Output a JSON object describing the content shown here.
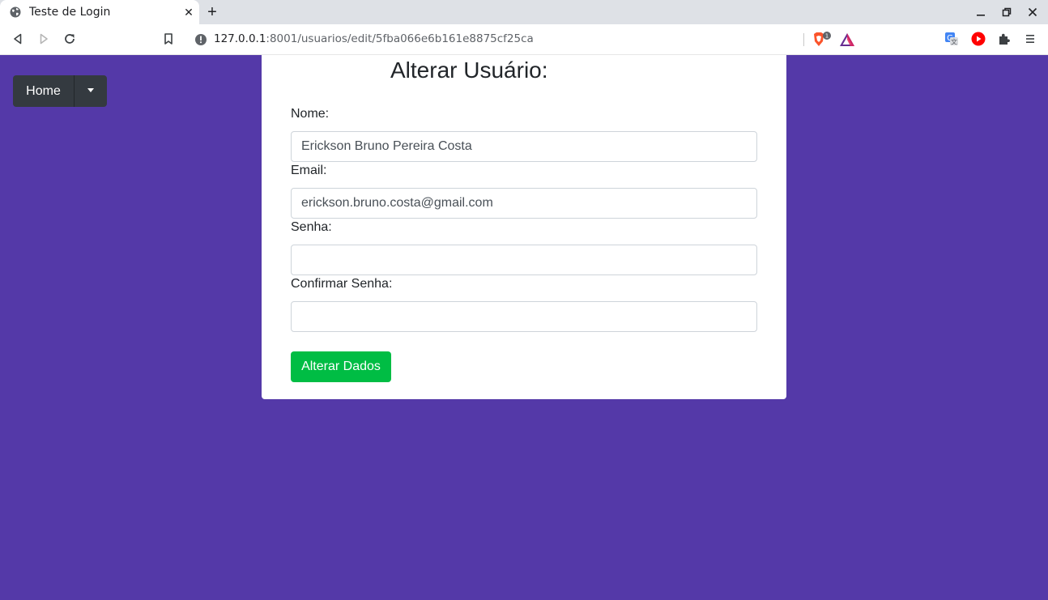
{
  "browser": {
    "tab_title": "Teste de Login",
    "close_symbol": "✕",
    "new_tab_symbol": "+",
    "url_host": "127.0.0.1",
    "url_rest": ":8001/usuarios/edit/5fba066e6b161e8875cf25ca",
    "brave_badge_count": "1"
  },
  "nav": {
    "home_label": "Home"
  },
  "form": {
    "title": "Alterar Usuário:",
    "name_label": "Nome:",
    "name_value": "Erickson Bruno Pereira Costa",
    "email_label": "Email:",
    "email_value": "erickson.bruno.costa@gmail.com",
    "password_label": "Senha:",
    "password_value": "",
    "confirm_label": "Confirmar Senha:",
    "confirm_value": "",
    "submit_label": "Alterar Dados"
  },
  "colors": {
    "page_background": "#5439a8",
    "submit_button": "#00bd44",
    "home_button": "#343a40"
  }
}
